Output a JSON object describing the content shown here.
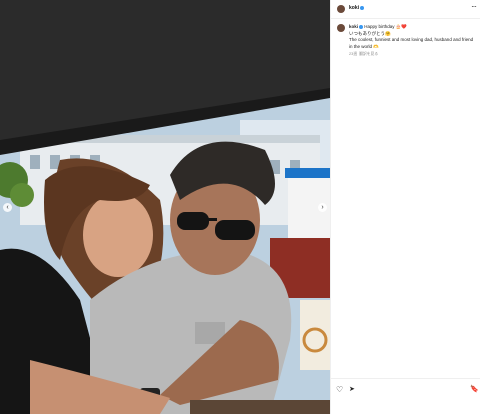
{
  "post": {
    "username": "koki",
    "caption_line1": "Happy birthday",
    "caption_emoji1": "🎂❤️",
    "caption_line2": "いつもありがとう",
    "caption_emoji2": "🤗",
    "caption_line3": "The coolest, funniest and most loving dad, husband and friend in the world",
    "caption_emoji3": "🫶",
    "timestamp": "23週",
    "meta_extra": "翻訳を見る"
  },
  "icons": {
    "more": "more-options-icon",
    "verified": "verified-badge-icon",
    "heart": "heart-icon",
    "share": "share-icon",
    "bookmark": "bookmark-icon",
    "prev": "chevron-left-icon",
    "next": "chevron-right-icon"
  },
  "glyphs": {
    "more": "···",
    "heart": "♡",
    "share": "➤",
    "bookmark": "🔖",
    "prev": "‹",
    "next": "›"
  },
  "colors": {
    "verified": "#3897f0",
    "text": "#111111",
    "muted": "#8e8e8e",
    "border": "#efefef"
  }
}
